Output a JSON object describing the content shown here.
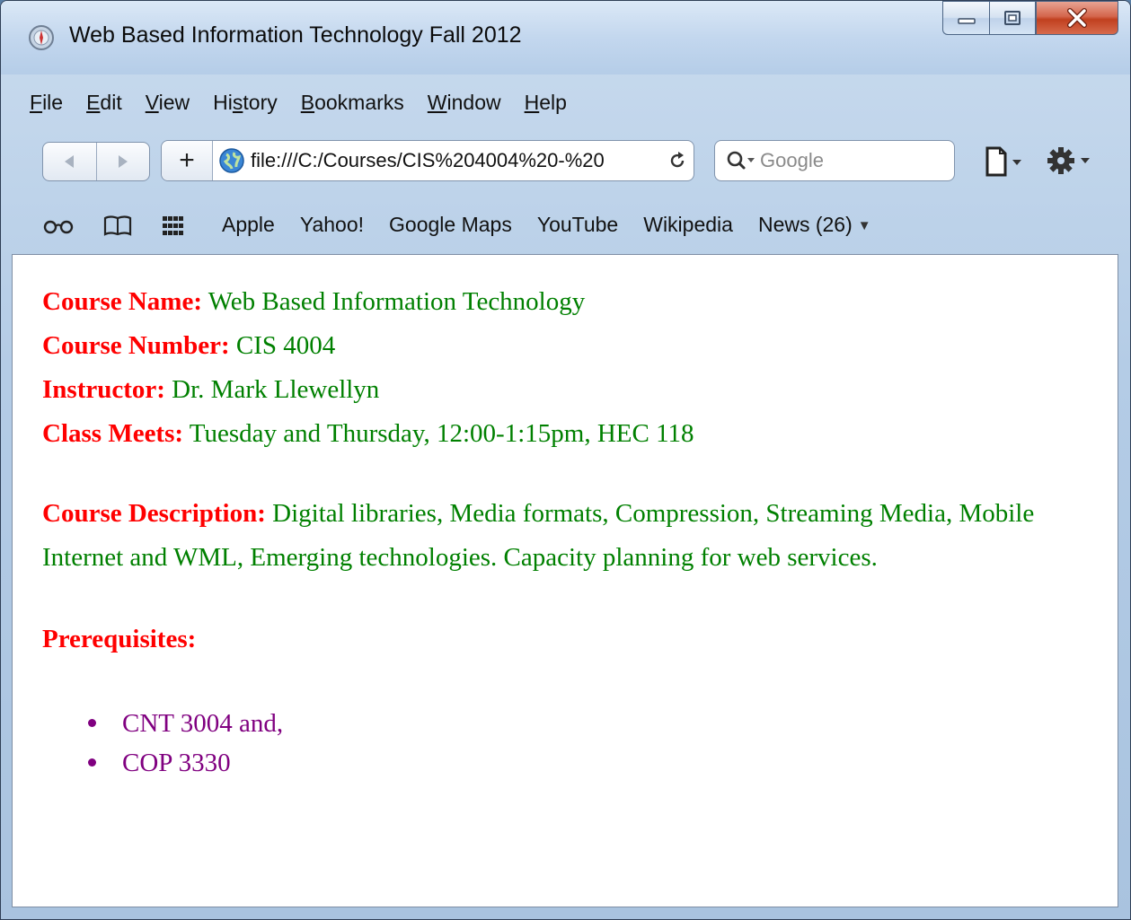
{
  "window": {
    "title": "Web Based Information Technology Fall 2012"
  },
  "menubar": {
    "items": [
      {
        "label": "File",
        "u": "F",
        "rest": "ile"
      },
      {
        "label": "Edit",
        "u": "E",
        "rest": "dit"
      },
      {
        "label": "View",
        "u": "V",
        "rest": "iew"
      },
      {
        "label": "History",
        "pre": "Hi",
        "u": "s",
        "rest": "tory"
      },
      {
        "label": "Bookmarks",
        "u": "B",
        "rest": "ookmarks"
      },
      {
        "label": "Window",
        "u": "W",
        "rest": "indow"
      },
      {
        "label": "Help",
        "u": "H",
        "rest": "elp"
      }
    ]
  },
  "toolbar": {
    "url": "file:///C:/Courses/CIS%204004%20-%20",
    "search_placeholder": "Google"
  },
  "bookmarks": {
    "links": [
      "Apple",
      "Yahoo!",
      "Google Maps",
      "YouTube",
      "Wikipedia",
      "News (26)"
    ]
  },
  "content": {
    "course_name_label": "Course Name:",
    "course_name": "Web Based Information Technology",
    "course_number_label": "Course Number:",
    "course_number": "CIS 4004",
    "instructor_label": "Instructor:",
    "instructor": "Dr. Mark Llewellyn",
    "class_meets_label": "Class Meets:",
    "class_meets": "Tuesday and Thursday, 12:00-1:15pm, HEC 118",
    "description_label": "Course Description:",
    "description": "Digital libraries, Media formats, Compression, Streaming Media, Mobile Internet and WML, Emerging technologies. Capacity planning for web services.",
    "prerequisites_label": "Prerequisites:",
    "prerequisites": [
      "CNT 3004 and,",
      "COP 3330"
    ]
  },
  "colors": {
    "label_red": "#ff0000",
    "value_green": "#008000",
    "list_purple": "#800080"
  }
}
